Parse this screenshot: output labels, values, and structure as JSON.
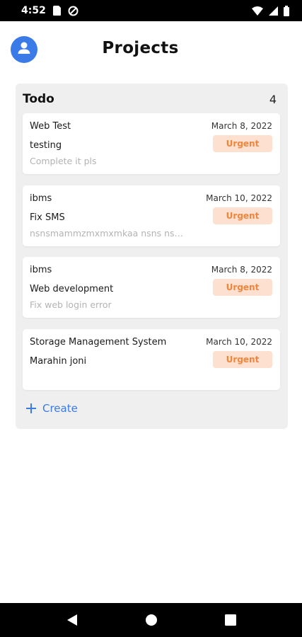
{
  "status_bar": {
    "time": "4:52",
    "icons_left": [
      "sim-card-icon",
      "data-saver-icon"
    ],
    "icons_right": [
      "wifi-icon",
      "signal-icon",
      "battery-icon"
    ]
  },
  "header": {
    "title": "Projects",
    "avatar_icon": "person-icon",
    "accent_color": "#3a7be8"
  },
  "column": {
    "title": "Todo",
    "count": "4",
    "cards": [
      {
        "project": "Web Test",
        "date": "March 8, 2022",
        "task": "testing",
        "description": "Complete it pls",
        "priority": "Urgent"
      },
      {
        "project": "ibms",
        "date": "March 10, 2022",
        "task": "Fix SMS",
        "description": "nsnsmammzmxmxmkaa nsns ns…",
        "priority": "Urgent"
      },
      {
        "project": "ibms",
        "date": "March 8, 2022",
        "task": "Web development",
        "description": "Fix web login error",
        "priority": "Urgent"
      },
      {
        "project": "Storage Management System",
        "date": "March 10, 2022",
        "task": "Marahin joni",
        "description": "",
        "priority": "Urgent"
      }
    ],
    "create_label": "Create"
  },
  "colors": {
    "badge_bg": "#fde0cf",
    "badge_text": "#f0863d",
    "column_bg": "#efefef"
  },
  "nav_bar": {
    "icons": [
      "back-icon",
      "home-icon",
      "recents-icon"
    ]
  }
}
